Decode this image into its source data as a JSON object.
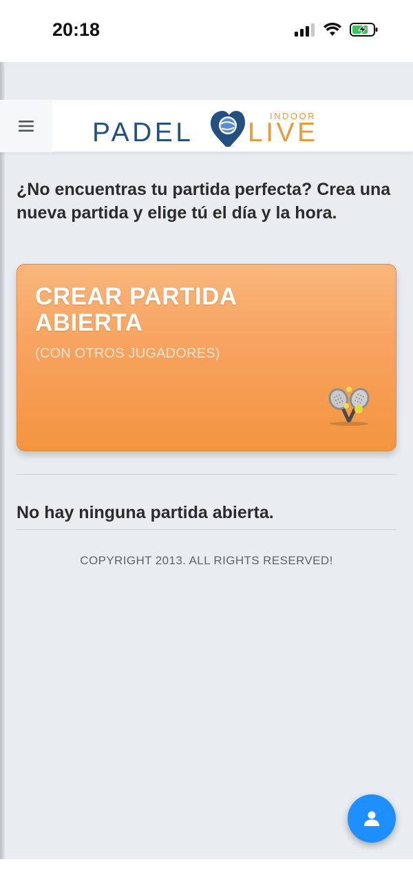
{
  "status_bar": {
    "time": "20:18"
  },
  "header": {
    "menu_icon": "hamburger-menu-icon",
    "logo": {
      "word_left": "PADEL",
      "word_right": "LIVE",
      "tag": "INDOOR",
      "colors": {
        "blue": "#23507f",
        "orange": "#e79a3c"
      }
    }
  },
  "main": {
    "intro_text": "¿No encuentras tu partida perfecta? Crea una nueva partida y elige tú el día y la hora.",
    "create_card": {
      "title": "CREAR PARTIDA ABIERTA",
      "subtitle": "(CON OTROS JUGADORES)",
      "icon": "padel-rackets-icon",
      "color": "#f7a25e"
    },
    "empty_message": "No hay ninguna partida abierta.",
    "copyright": "COPYRIGHT 2013. ALL RIGHTS RESERVED!"
  },
  "fab": {
    "icon": "user-icon",
    "color": "#1d8fff"
  }
}
